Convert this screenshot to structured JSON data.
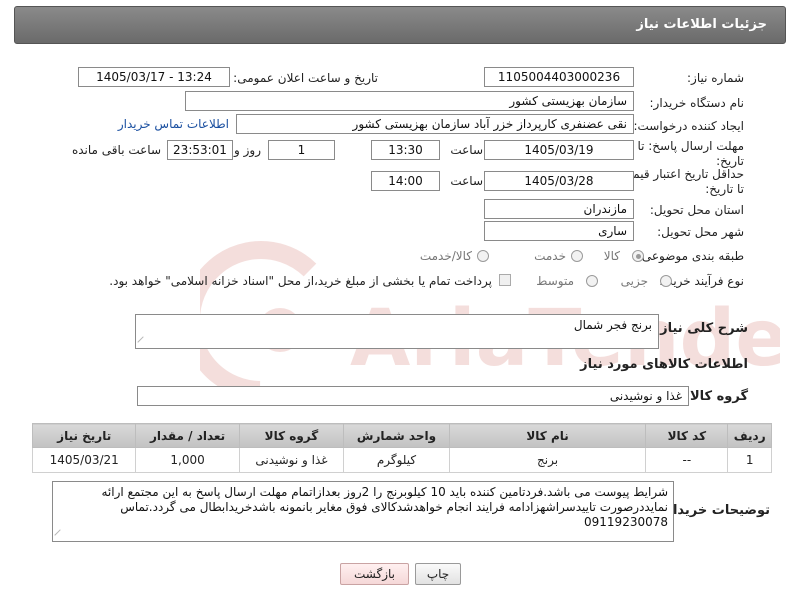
{
  "header": {
    "title": "جزئیات اطلاعات نیاز"
  },
  "labels": {
    "need_number": "شماره نیاز:",
    "announce_datetime": "تاریخ و ساعت اعلان عمومی:",
    "buyer_org": "نام دستگاه خریدار:",
    "requester": "ایجاد کننده درخواست:",
    "contact_link": "اطلاعات تماس خریدار",
    "reply_deadline": "مهلت ارسال پاسخ: تا تاریخ:",
    "price_validity": "حداقل تاریخ اعتبار قیمت: تا تاریخ:",
    "time_word": "ساعت",
    "day_word": "روز و",
    "remaining_word": "ساعت باقی مانده",
    "province": "استان محل تحویل:",
    "city": "شهر محل تحویل:",
    "category": "طبقه بندی موضوعی:",
    "process_type": "نوع فرآیند خرید :",
    "description": "شرح کلی نیاز:",
    "goods_info": "اطلاعات کالاهای مورد نیاز",
    "goods_group": "گروه کالا:",
    "buyer_notes": "توضیحات خریدار:"
  },
  "values": {
    "need_number": "1105004403000236",
    "announce_datetime": "1405/03/17 - 13:24",
    "buyer_org": "سازمان بهزیستی کشور",
    "requester": "نقی عضنفری کارپرداز خزر آباد سازمان بهزیستی کشور",
    "reply_date": "1405/03/19",
    "reply_time": "13:30",
    "reply_days": "1",
    "reply_remaining": "23:53:01",
    "validity_date": "1405/03/28",
    "validity_time": "14:00",
    "province": "مازندران",
    "city": "ساری",
    "description": "برنج فجر شمال",
    "goods_group": "غذا و نوشیدنی",
    "buyer_notes": "شرایط پیوست می باشد.فردتامین کننده باید 10 کیلوبرنج را 2روز بعدازاتمام مهلت ارسال پاسخ به این مجتمع ارائه نمایددرصورت تاییدسراشهزادامه فرایند انجام خواهدشدکالای فوق مغایر بانمونه باشدخریدابطال می گردد.تماس 09119230078"
  },
  "category_options": [
    {
      "label": "کالا",
      "selected": true
    },
    {
      "label": "خدمت",
      "selected": false
    },
    {
      "label": "کالا/خدمت",
      "selected": false
    }
  ],
  "process_options": [
    {
      "label": "جزیی",
      "selected": false
    },
    {
      "label": "متوسط",
      "selected": false
    }
  ],
  "payment_note": "پرداخت تمام یا بخشی از مبلغ خرید،از محل \"اسناد خزانه اسلامی\" خواهد بود.",
  "table": {
    "headers": [
      "ردیف",
      "کد کالا",
      "نام کالا",
      "واحد شمارش",
      "گروه کالا",
      "تعداد / مقدار",
      "تاریخ نیاز"
    ],
    "rows": [
      [
        "1",
        "--",
        "برنج",
        "کیلوگرم",
        "غذا و نوشیدنی",
        "1,000",
        "1405/03/21"
      ]
    ]
  },
  "buttons": {
    "print": "چاپ",
    "back": "بازگشت"
  },
  "watermark": {
    "text": "AriaTender.net"
  }
}
